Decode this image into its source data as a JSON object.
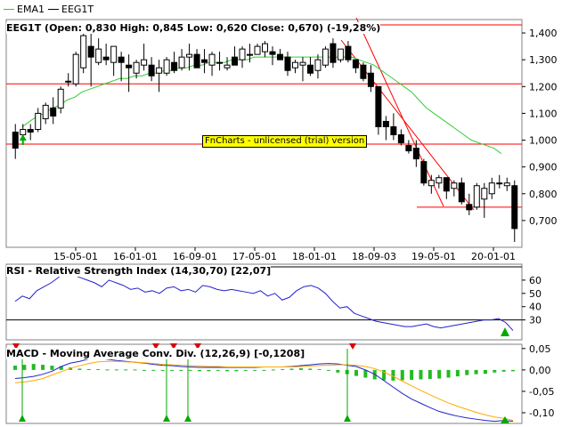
{
  "legend": {
    "ema_label": "EMA1",
    "ema_color": "#33cc33",
    "price_label": "EEG1T",
    "price_color": "#000000"
  },
  "price_panel": {
    "title": "EEG1T (Open: 0,830  High: 0,845  Low: 0,620  Close: 0,670) (-19,28%)",
    "y_ticks": [
      "1,400",
      "1,300",
      "1,200",
      "1,100",
      "1,000",
      "0,900",
      "0,800",
      "0,700"
    ],
    "x_ticks": [
      "15-05-01",
      "16-01-01",
      "16-09-01",
      "17-05-01",
      "18-01-01",
      "18-09-03",
      "19-05-01",
      "20-01-01"
    ],
    "watermark": "FnCharts - unlicensed (trial) version",
    "up_color": "#ffffff",
    "down_color": "#000000",
    "line_color": "#ff0000"
  },
  "rsi_panel": {
    "title": "RSI - Relative Strength Index (14,30,70) [22,07]",
    "y_ticks": [
      "60",
      "50",
      "40",
      "30"
    ],
    "line_color": "#2222cc"
  },
  "macd_panel": {
    "title": "MACD - Moving Average Conv. Div. (12,26,9) [-0,1208]",
    "y_ticks": [
      "0,05",
      "0,00",
      "-0,05",
      "-0,10"
    ],
    "macd_color": "#2222cc",
    "signal_color": "#ffaa00",
    "hist_color": "#22bb22"
  },
  "chart_data": {
    "type": "candlestick",
    "title": "EEG1T (Open: 0,830  High: 0,845  Low: 0,620  Close: 0,670) (-19,28%)",
    "x_tick_labels": [
      "15-05-01",
      "16-01-01",
      "16-09-01",
      "17-05-01",
      "18-01-01",
      "18-09-03",
      "19-05-01",
      "20-01-01"
    ],
    "ylim": [
      0.6,
      1.45
    ],
    "candles": [
      {
        "o": 1.03,
        "h": 1.06,
        "l": 0.93,
        "c": 0.97
      },
      {
        "o": 1.02,
        "h": 1.06,
        "l": 1.01,
        "c": 1.04
      },
      {
        "o": 1.04,
        "h": 1.06,
        "l": 1.0,
        "c": 1.03
      },
      {
        "o": 1.04,
        "h": 1.12,
        "l": 1.03,
        "c": 1.1
      },
      {
        "o": 1.08,
        "h": 1.14,
        "l": 1.06,
        "c": 1.13
      },
      {
        "o": 1.12,
        "h": 1.16,
        "l": 1.06,
        "c": 1.09
      },
      {
        "o": 1.12,
        "h": 1.2,
        "l": 1.1,
        "c": 1.19
      },
      {
        "o": 1.22,
        "h": 1.25,
        "l": 1.2,
        "c": 1.22
      },
      {
        "o": 1.21,
        "h": 1.33,
        "l": 1.2,
        "c": 1.32
      },
      {
        "o": 1.27,
        "h": 1.42,
        "l": 1.25,
        "c": 1.39
      },
      {
        "o": 1.35,
        "h": 1.4,
        "l": 1.2,
        "c": 1.31
      },
      {
        "o": 1.29,
        "h": 1.38,
        "l": 1.28,
        "c": 1.34
      },
      {
        "o": 1.31,
        "h": 1.36,
        "l": 1.28,
        "c": 1.3
      },
      {
        "o": 1.29,
        "h": 1.35,
        "l": 1.24,
        "c": 1.35
      },
      {
        "o": 1.31,
        "h": 1.33,
        "l": 1.22,
        "c": 1.29
      },
      {
        "o": 1.28,
        "h": 1.32,
        "l": 1.18,
        "c": 1.27
      },
      {
        "o": 1.25,
        "h": 1.3,
        "l": 1.23,
        "c": 1.29
      },
      {
        "o": 1.28,
        "h": 1.36,
        "l": 1.26,
        "c": 1.3
      },
      {
        "o": 1.28,
        "h": 1.31,
        "l": 1.22,
        "c": 1.24
      },
      {
        "o": 1.25,
        "h": 1.3,
        "l": 1.18,
        "c": 1.27
      },
      {
        "o": 1.25,
        "h": 1.31,
        "l": 1.24,
        "c": 1.3
      },
      {
        "o": 1.29,
        "h": 1.33,
        "l": 1.25,
        "c": 1.26
      },
      {
        "o": 1.27,
        "h": 1.34,
        "l": 1.26,
        "c": 1.31
      },
      {
        "o": 1.31,
        "h": 1.36,
        "l": 1.26,
        "c": 1.32
      },
      {
        "o": 1.32,
        "h": 1.34,
        "l": 1.28,
        "c": 1.27
      },
      {
        "o": 1.3,
        "h": 1.34,
        "l": 1.25,
        "c": 1.29
      },
      {
        "o": 1.28,
        "h": 1.33,
        "l": 1.24,
        "c": 1.32
      },
      {
        "o": 1.29,
        "h": 1.33,
        "l": 1.26,
        "c": 1.29
      },
      {
        "o": 1.27,
        "h": 1.31,
        "l": 1.26,
        "c": 1.28
      },
      {
        "o": 1.31,
        "h": 1.35,
        "l": 1.28,
        "c": 1.28
      },
      {
        "o": 1.3,
        "h": 1.35,
        "l": 1.27,
        "c": 1.34
      },
      {
        "o": 1.32,
        "h": 1.36,
        "l": 1.29,
        "c": 1.32
      },
      {
        "o": 1.32,
        "h": 1.36,
        "l": 1.32,
        "c": 1.35
      },
      {
        "o": 1.33,
        "h": 1.37,
        "l": 1.31,
        "c": 1.36
      },
      {
        "o": 1.33,
        "h": 1.35,
        "l": 1.28,
        "c": 1.32
      },
      {
        "o": 1.32,
        "h": 1.34,
        "l": 1.3,
        "c": 1.3
      },
      {
        "o": 1.31,
        "h": 1.33,
        "l": 1.24,
        "c": 1.26
      },
      {
        "o": 1.27,
        "h": 1.3,
        "l": 1.25,
        "c": 1.29
      },
      {
        "o": 1.28,
        "h": 1.31,
        "l": 1.22,
        "c": 1.29
      },
      {
        "o": 1.28,
        "h": 1.31,
        "l": 1.24,
        "c": 1.25
      },
      {
        "o": 1.26,
        "h": 1.32,
        "l": 1.23,
        "c": 1.3
      },
      {
        "o": 1.28,
        "h": 1.35,
        "l": 1.27,
        "c": 1.34
      },
      {
        "o": 1.36,
        "h": 1.38,
        "l": 1.27,
        "c": 1.29
      },
      {
        "o": 1.3,
        "h": 1.34,
        "l": 1.29,
        "c": 1.34
      },
      {
        "o": 1.35,
        "h": 1.37,
        "l": 1.29,
        "c": 1.3
      },
      {
        "o": 1.3,
        "h": 1.3,
        "l": 1.25,
        "c": 1.27
      },
      {
        "o": 1.28,
        "h": 1.29,
        "l": 1.22,
        "c": 1.23
      },
      {
        "o": 1.25,
        "h": 1.28,
        "l": 1.18,
        "c": 1.2
      },
      {
        "o": 1.2,
        "h": 1.2,
        "l": 1.02,
        "c": 1.05
      },
      {
        "o": 1.07,
        "h": 1.09,
        "l": 1.0,
        "c": 1.05
      },
      {
        "o": 1.05,
        "h": 1.1,
        "l": 1.0,
        "c": 1.02
      },
      {
        "o": 1.02,
        "h": 1.04,
        "l": 0.98,
        "c": 0.99
      },
      {
        "o": 0.98,
        "h": 1.0,
        "l": 0.95,
        "c": 0.96
      },
      {
        "o": 0.97,
        "h": 1.0,
        "l": 0.9,
        "c": 0.93
      },
      {
        "o": 0.92,
        "h": 0.93,
        "l": 0.83,
        "c": 0.84
      },
      {
        "o": 0.83,
        "h": 0.87,
        "l": 0.8,
        "c": 0.85
      },
      {
        "o": 0.84,
        "h": 0.87,
        "l": 0.82,
        "c": 0.86
      },
      {
        "o": 0.86,
        "h": 0.86,
        "l": 0.78,
        "c": 0.81
      },
      {
        "o": 0.82,
        "h": 0.85,
        "l": 0.79,
        "c": 0.84
      },
      {
        "o": 0.84,
        "h": 0.86,
        "l": 0.76,
        "c": 0.77
      },
      {
        "o": 0.76,
        "h": 0.8,
        "l": 0.72,
        "c": 0.74
      },
      {
        "o": 0.75,
        "h": 0.84,
        "l": 0.74,
        "c": 0.83
      },
      {
        "o": 0.78,
        "h": 0.84,
        "l": 0.71,
        "c": 0.82
      },
      {
        "o": 0.8,
        "h": 0.86,
        "l": 0.78,
        "c": 0.84
      },
      {
        "o": 0.84,
        "h": 0.87,
        "l": 0.82,
        "c": 0.84
      },
      {
        "o": 0.83,
        "h": 0.86,
        "l": 0.81,
        "c": 0.84
      },
      {
        "o": 0.83,
        "h": 0.85,
        "l": 0.62,
        "c": 0.67
      }
    ],
    "ema": [
      1.05,
      1.07,
      1.09,
      1.1,
      1.12,
      1.13,
      1.15,
      1.16,
      1.18,
      1.19,
      1.2,
      1.21,
      1.22,
      1.23,
      1.23,
      1.24,
      1.24,
      1.25,
      1.25,
      1.26,
      1.26,
      1.27,
      1.27,
      1.28,
      1.28,
      1.29,
      1.29,
      1.29,
      1.3,
      1.3,
      1.3,
      1.31,
      1.31,
      1.31,
      1.31,
      1.31,
      1.31,
      1.31,
      1.31,
      1.31,
      1.31,
      1.31,
      1.31,
      1.31,
      1.31,
      1.3,
      1.29,
      1.28,
      1.26,
      1.24,
      1.22,
      1.2,
      1.18,
      1.15,
      1.12,
      1.1,
      1.08,
      1.06,
      1.04,
      1.02,
      1.0,
      0.99,
      0.98,
      0.97,
      0.95
    ],
    "horizontal_lines": [
      1.43,
      1.21,
      0.985,
      0.75
    ],
    "rsi": {
      "ylim": [
        15,
        72
      ],
      "levels": [
        30,
        70
      ],
      "values": [
        44,
        48,
        46,
        52,
        55,
        58,
        62,
        68,
        64,
        62,
        60,
        58,
        55,
        60,
        58,
        56,
        53,
        54,
        51,
        52,
        50,
        54,
        55,
        52,
        53,
        51,
        56,
        55,
        53,
        52,
        53,
        52,
        51,
        50,
        52,
        48,
        50,
        45,
        47,
        52,
        55,
        56,
        54,
        50,
        44,
        39,
        40,
        35,
        33,
        31,
        29,
        28,
        27,
        26,
        25,
        25,
        26,
        27,
        25,
        24,
        25,
        26,
        27,
        28,
        29,
        30,
        30,
        31,
        28,
        22
      ]
    },
    "macd": {
      "ylim": [
        -0.125,
        0.06
      ],
      "macd": [
        -0.02,
        -0.018,
        -0.015,
        -0.01,
        -0.003,
        0.008,
        0.016,
        0.02,
        0.026,
        0.028,
        0.025,
        0.022,
        0.02,
        0.018,
        0.016,
        0.013,
        0.011,
        0.01,
        0.008,
        0.007,
        0.006,
        0.006,
        0.006,
        0.006,
        0.006,
        0.006,
        0.006,
        0.007,
        0.007,
        0.007,
        0.008,
        0.01,
        0.012,
        0.014,
        0.015,
        0.014,
        0.011,
        0.008,
        0.0,
        -0.01,
        -0.025,
        -0.04,
        -0.055,
        -0.068,
        -0.078,
        -0.088,
        -0.097,
        -0.103,
        -0.108,
        -0.112,
        -0.115,
        -0.118,
        -0.12,
        -0.118,
        -0.12
      ],
      "signal": [
        -0.03,
        -0.028,
        -0.025,
        -0.02,
        -0.012,
        -0.004,
        0.004,
        0.01,
        0.015,
        0.019,
        0.02,
        0.02,
        0.019,
        0.018,
        0.017,
        0.015,
        0.013,
        0.012,
        0.011,
        0.01,
        0.009,
        0.008,
        0.008,
        0.007,
        0.007,
        0.007,
        0.007,
        0.007,
        0.007,
        0.007,
        0.007,
        0.008,
        0.009,
        0.01,
        0.011,
        0.012,
        0.012,
        0.011,
        0.008,
        0.003,
        -0.005,
        -0.015,
        -0.026,
        -0.037,
        -0.048,
        -0.058,
        -0.068,
        -0.077,
        -0.085,
        -0.092,
        -0.099,
        -0.105,
        -0.11,
        -0.113,
        -0.118
      ],
      "histogram": [
        0.01,
        0.012,
        0.014,
        0.012,
        0.01,
        0.009,
        0.006,
        0.003,
        0.002,
        0.002,
        0.001,
        0.001,
        0.001,
        0.001,
        0.0,
        0.0,
        0.0,
        -0.001,
        -0.002,
        -0.002,
        -0.003,
        -0.003,
        -0.002,
        -0.003,
        -0.003,
        -0.002,
        -0.001,
        0.0,
        0.001,
        0.002,
        0.003,
        0.004,
        0.003,
        0.002,
        0.0,
        -0.006,
        -0.01,
        -0.014,
        -0.018,
        -0.022,
        -0.024,
        -0.025,
        -0.024,
        -0.023,
        -0.022,
        -0.021,
        -0.02,
        -0.018,
        -0.015,
        -0.012,
        -0.01,
        -0.009,
        -0.006,
        -0.004,
        -0.003
      ]
    },
    "buy_signals_price": [
      1
    ],
    "macd_buy_markers": [
      1,
      38,
      43,
      84
    ],
    "macd_sell_markers": [
      1,
      36,
      40,
      45,
      85
    ],
    "rsi_buy_marker": [
      125
    ]
  }
}
